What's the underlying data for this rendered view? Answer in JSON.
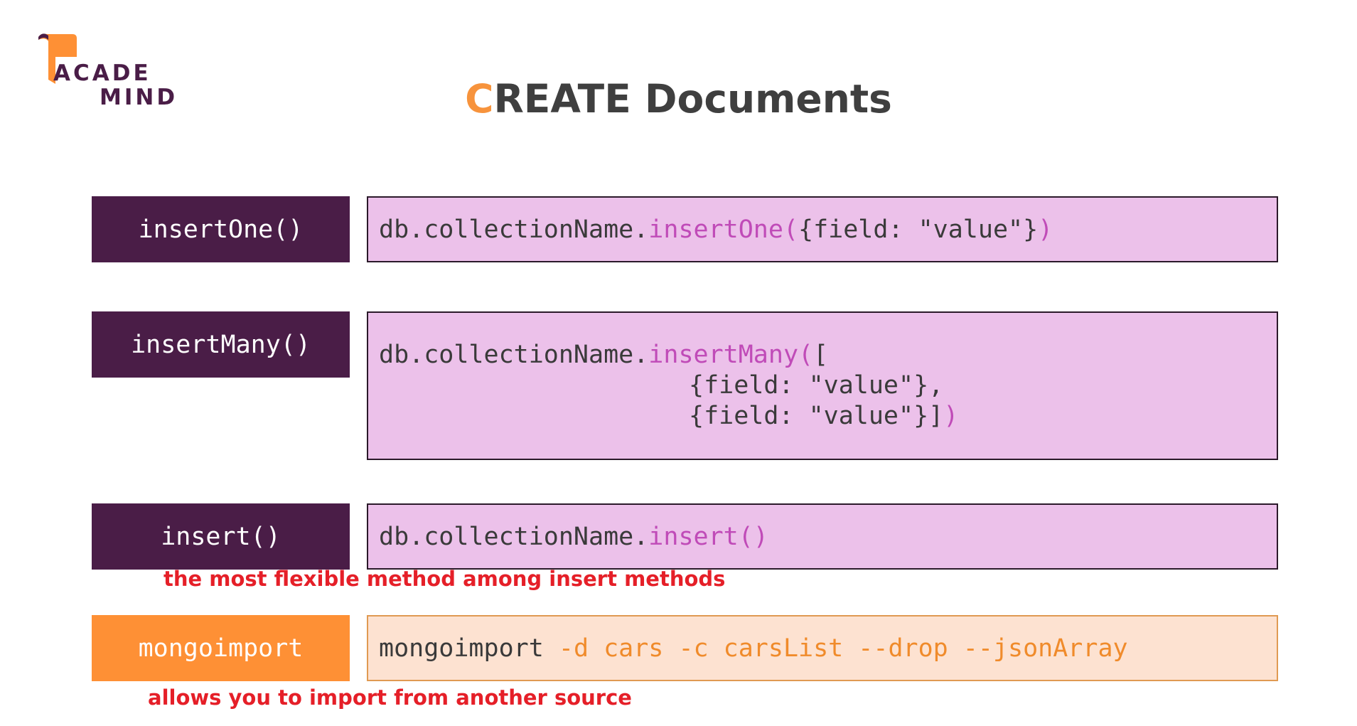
{
  "logo": {
    "line1": "ACADE",
    "line2": "MIND",
    "colors": {
      "mark": "#fe9035",
      "text": "#4a1d47"
    }
  },
  "title": {
    "first_letter": "C",
    "rest": "REATE Documents"
  },
  "rows": [
    {
      "label": "insertOne()",
      "code_prefix": "db.collectionName.",
      "code_method": "insertOne(",
      "code_args": "{field: \"value\"}",
      "code_close": ")"
    },
    {
      "label": "insertMany()",
      "code_prefix": "db.collectionName.",
      "code_method": "insertMany(",
      "code_open": "[",
      "code_line2": "{field: \"value\"},",
      "code_line3_args": "{field: \"value\"}]",
      "code_close": ")"
    },
    {
      "label": "insert()",
      "code_prefix": "db.collectionName.",
      "code_method": "insert()"
    },
    {
      "label": "mongoimport",
      "code_prefix": "mongoimport",
      "code_flags": " -d cars -c carsList --drop --jsonArray"
    }
  ],
  "notes": {
    "insert": "the most flexible method among insert methods",
    "mongoimport": "allows you to import from another source"
  },
  "colors": {
    "dark_purple": "#4a1d47",
    "orange": "#fe9035",
    "pink_box": "#ecc1ea",
    "peach_box": "#fde2d1",
    "method_magenta": "#c04bb8",
    "flag_orange": "#f08b2b",
    "note_red": "#e51f28",
    "title_gray": "#3f3f3f"
  }
}
